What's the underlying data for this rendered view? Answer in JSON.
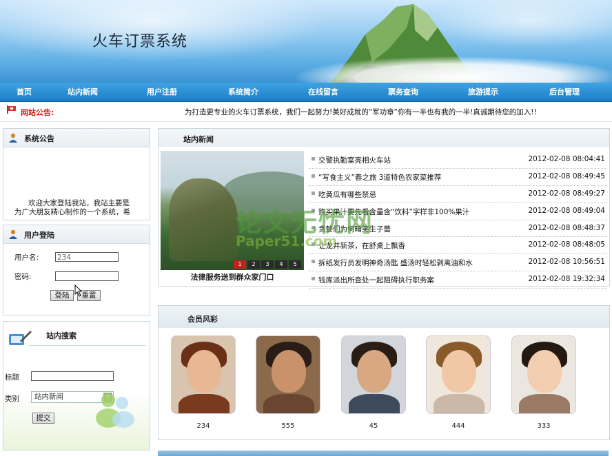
{
  "banner": {
    "title": "火车订票系统"
  },
  "nav": {
    "items": [
      "首页",
      "站内新闻",
      "用户注册",
      "系统简介",
      "在线留言",
      "票务查询",
      "旅游提示",
      "后台管理"
    ]
  },
  "notice": {
    "label": "网站公告:",
    "text": "为打造更专业的火车订票系统，我们一起努力!美好成就的“军功章”你有一半也有我的一半!真诚期待您的加入!!"
  },
  "system_notice": {
    "title": "系统公告",
    "text_line1": "欢迎大家登陆我站，我站主要是",
    "text_line2": "为广大朋友精心制作的一个系统，希"
  },
  "login": {
    "title": "用户登陆",
    "username_label": "用户名:",
    "username_value": "234",
    "password_label": "密码:",
    "login_button": "登陆",
    "reset_button": "重置"
  },
  "search": {
    "title": "站内搜索",
    "title_label": "标题",
    "category_label": "类别",
    "category_value": "站内新闻",
    "submit_button": "提交"
  },
  "news": {
    "title": "站内新闻",
    "caption": "法律服务送到群众家门口",
    "pager": [
      "1",
      "2",
      "3",
      "4",
      "5"
    ],
    "items": [
      {
        "title": "交警执勤室亮相火车站",
        "date": "2012-02-08 08:04:41"
      },
      {
        "title": "“写食主义”春之旅 3道特色农家菜推荐",
        "date": "2012-02-08 08:49:45"
      },
      {
        "title": "吃黄瓜有哪些禁忌",
        "date": "2012-02-08 08:49:27"
      },
      {
        "title": "购买果汁要先看含量含“饮料”字样非100%果汁",
        "date": "2012-02-08 08:49:04"
      },
      {
        "title": "贪婪们为何暗笑生子蕾",
        "date": "2012-02-08 08:48:37"
      },
      {
        "title": "让龙井新茶，在舒桌上飘香",
        "date": "2012-02-08 08:48:05"
      },
      {
        "title": "拆纸发行员发明神奇汤匙 盛汤时轻松剥离油和水",
        "date": "2012-02-08 10:56:51"
      },
      {
        "title": "钱库派出所查处一起阻碍执行职务案",
        "date": "2012-02-08 19:32:34"
      }
    ]
  },
  "members": {
    "title": "会员风彩",
    "list": [
      {
        "name": "234",
        "color": "#7a3a1e"
      },
      {
        "name": "555",
        "color": "#6a4630"
      },
      {
        "name": "45",
        "color": "#3c4a5c"
      },
      {
        "name": "444",
        "color": "#c9b9a6"
      },
      {
        "name": "333",
        "color": "#9a7a62"
      }
    ]
  },
  "watermark": {
    "line1": "论文无忧网",
    "line2": "Paper51.com"
  }
}
